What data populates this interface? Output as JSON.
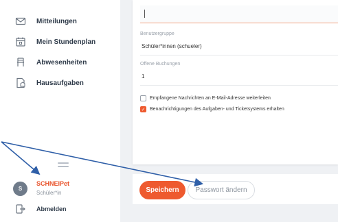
{
  "sidebar": {
    "items": [
      {
        "label": "Mitteilungen",
        "icon": "mail-icon"
      },
      {
        "label": "Mein Stundenplan",
        "icon": "calendar-icon"
      },
      {
        "label": "Abwesenheiten",
        "icon": "chair-icon"
      },
      {
        "label": "Hausaufgaben",
        "icon": "homework-icon"
      }
    ],
    "user": {
      "initial": "S",
      "name": "SCHNEIPet",
      "role": "Schüler*in"
    },
    "logout_label": "Abmelden"
  },
  "form": {
    "input_value": "",
    "group_label": "Benutzergruppe",
    "group_value": "Schüler*innen (schueler)",
    "bookings_label": "Offene Buchungen",
    "bookings_value": "1",
    "checkboxes": [
      {
        "label": "Empfangene Nachrichten an E-Mail-Adresse weiterleiten",
        "checked": false
      },
      {
        "label": "Benachrichtigungen des Aufgaben- und Ticketsystems erhalten",
        "checked": true
      }
    ]
  },
  "actions": {
    "save_label": "Speichern",
    "password_label": "Passwort ändern"
  },
  "colors": {
    "accent": "#ee5a2f",
    "arrow": "#2f5fa8"
  }
}
